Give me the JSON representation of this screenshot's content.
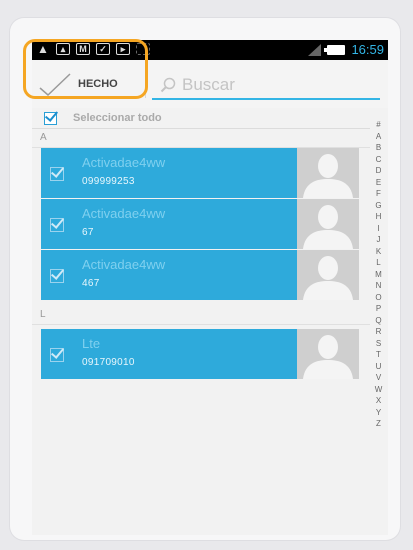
{
  "status_bar": {
    "time": "16:59",
    "icons": [
      "warning-icon",
      "image-icon",
      "gmail-icon",
      "check-icon",
      "download-icon",
      "grid-icon",
      "signal-icon",
      "battery-icon"
    ]
  },
  "action_bar": {
    "done_label": "HECHO",
    "search_placeholder": "Buscar",
    "search_value": ""
  },
  "select_all": {
    "label": "Seleccionar todo",
    "checked": true
  },
  "sections": [
    {
      "header": "A",
      "contacts": [
        {
          "name": "Activadae4ww",
          "phone": "099999253",
          "checked": true
        },
        {
          "name": "Activadae4ww",
          "phone": "67",
          "checked": true
        },
        {
          "name": "Activadae4ww",
          "phone": "467",
          "checked": true
        }
      ]
    },
    {
      "header": "L",
      "contacts": [
        {
          "name": "Lte",
          "phone": "091709010",
          "checked": true
        }
      ]
    }
  ],
  "alphabet": [
    "#",
    "A",
    "B",
    "C",
    "D",
    "E",
    "F",
    "G",
    "H",
    "I",
    "J",
    "K",
    "L",
    "M",
    "N",
    "O",
    "P",
    "Q",
    "R",
    "S",
    "T",
    "U",
    "V",
    "W",
    "X",
    "Y",
    "Z"
  ],
  "colors": {
    "accent": "#33b5e5",
    "row_selected": "#2eaadb",
    "highlight": "#f5a623"
  }
}
